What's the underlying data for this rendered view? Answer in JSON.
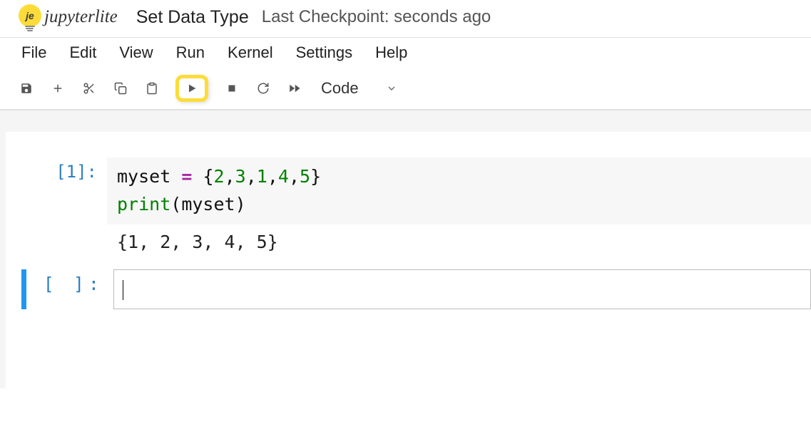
{
  "logo": {
    "text": "je",
    "script": "jupyterlite"
  },
  "document": {
    "title": "Set Data Type",
    "checkpoint": "Last Checkpoint: seconds ago"
  },
  "menubar": [
    "File",
    "Edit",
    "View",
    "Run",
    "Kernel",
    "Settings",
    "Help"
  ],
  "toolbar": {
    "cell_type": "Code"
  },
  "cells": [
    {
      "prompt": "[1]:",
      "code": {
        "line1": {
          "var": "myset",
          "op": "=",
          "open": "{",
          "values": [
            "2",
            "3",
            "1",
            "4",
            "5"
          ],
          "close": "}"
        },
        "line2": {
          "fn": "print",
          "arg": "myset"
        }
      },
      "output": "{1, 2, 3, 4, 5}"
    },
    {
      "prompt": "[ ]:"
    }
  ]
}
